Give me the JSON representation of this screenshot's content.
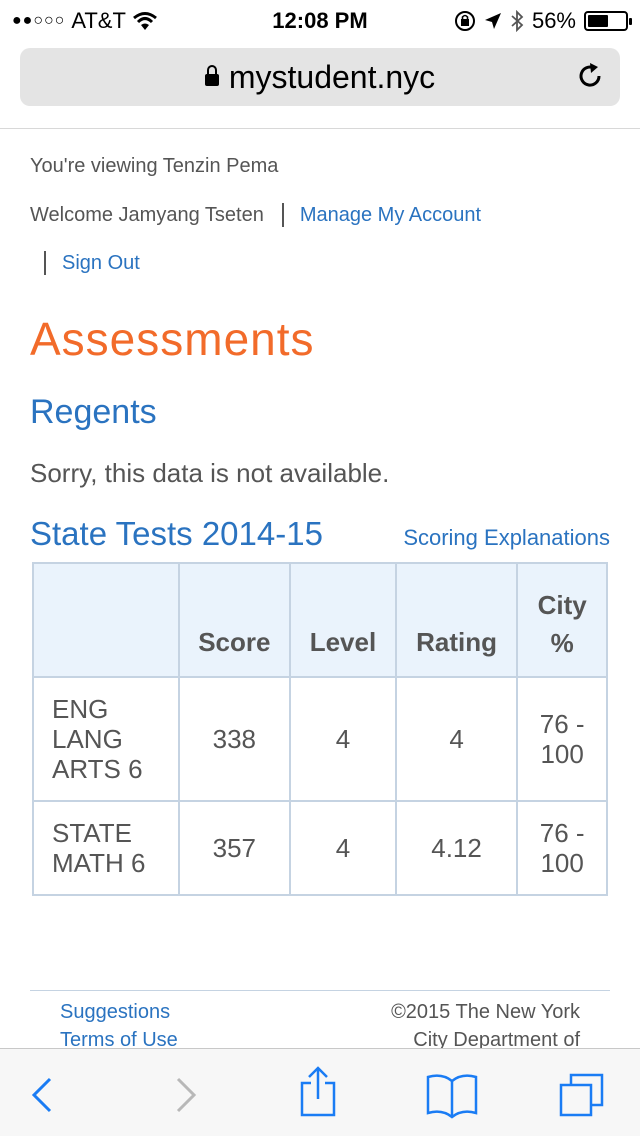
{
  "status_bar": {
    "carrier": "AT&T",
    "signal_dots": "●●○○○",
    "time": "12:08 PM",
    "battery": "56%",
    "battery_level": 0.56
  },
  "browser": {
    "url": "mystudent.nyc"
  },
  "header": {
    "viewing_text": "You're viewing Tenzin Pema",
    "welcome_text": "Welcome Jamyang Tseten",
    "manage_account_link": "Manage My Account",
    "sign_out_link": "Sign Out"
  },
  "main": {
    "title": "Assessments",
    "regents_heading": "Regents",
    "regents_message": "Sorry, this data is not available.",
    "state_tests_heading": "State Tests 2014-15",
    "scoring_link": "Scoring Explanations",
    "table": {
      "headers": [
        "",
        "Score",
        "Level",
        "Rating",
        "City",
        "%"
      ],
      "rows": [
        {
          "name_lines": [
            "ENG",
            "LANG",
            "ARTS 6"
          ],
          "score": "338",
          "level": "4",
          "rating": "4",
          "city_lines": [
            "76 -",
            "100"
          ]
        },
        {
          "name_lines": [
            "STATE",
            "MATH 6"
          ],
          "score": "357",
          "level": "4",
          "rating": "4.12",
          "city_lines": [
            "76 -",
            "100"
          ]
        }
      ]
    }
  },
  "footer": {
    "suggestions_link": "Suggestions",
    "terms_link": "Terms of Use",
    "copyright_line1": "©2015 The New York",
    "copyright_line2": "City Department of"
  },
  "colors": {
    "accent_orange": "#f26b2a",
    "link_blue": "#2a73c0",
    "ios_blue": "#1a7cf4",
    "table_header_bg": "#eaf3fc"
  },
  "icons": {
    "back": "chevron-left-icon",
    "forward": "chevron-right-icon",
    "share": "share-icon",
    "bookmarks": "book-icon",
    "tabs": "tabs-icon"
  }
}
